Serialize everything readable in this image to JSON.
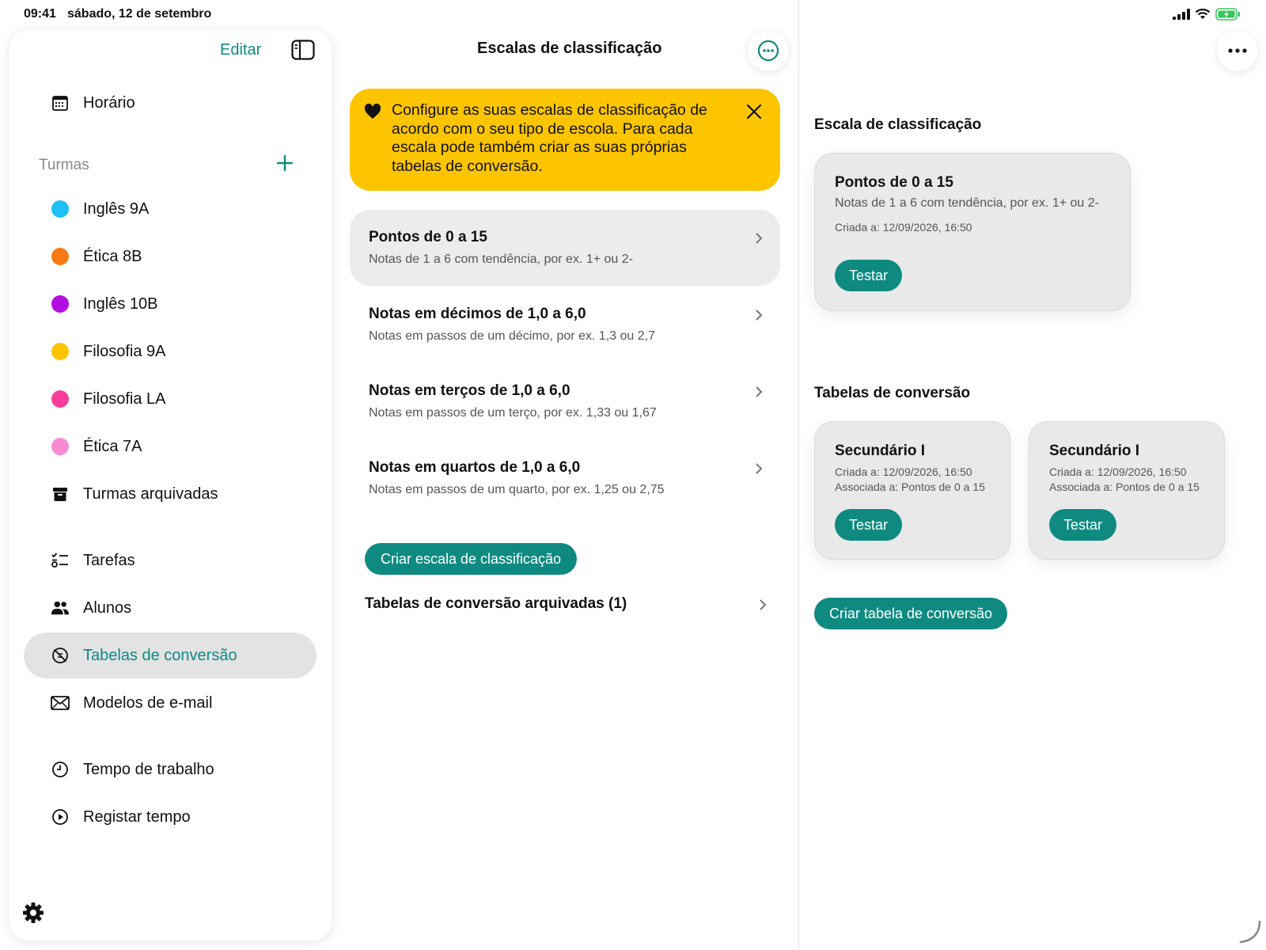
{
  "statusbar": {
    "time": "09:41",
    "date": "sábado, 12 de setembro"
  },
  "sidebar": {
    "edit_label": "Editar",
    "schedule_label": "Horário",
    "classes_header": "Turmas",
    "classes": [
      {
        "label": "Inglês 9A",
        "color": "#1ec0f5"
      },
      {
        "label": "Ética 8B",
        "color": "#f97a14"
      },
      {
        "label": "Inglês 10B",
        "color": "#b40fe0"
      },
      {
        "label": "Filosofia 9A",
        "color": "#fdc500"
      },
      {
        "label": "Filosofia LA",
        "color": "#f83d9a"
      },
      {
        "label": "Ética 7A",
        "color": "#f88ad4"
      }
    ],
    "archived_classes_label": "Turmas arquivadas",
    "tasks_label": "Tarefas",
    "students_label": "Alunos",
    "conversion_tables_label": "Tabelas de conversão",
    "email_templates_label": "Modelos de e-mail",
    "work_time_label": "Tempo de trabalho",
    "register_time_label": "Registar tempo"
  },
  "middle": {
    "title": "Escalas de classificação",
    "banner_text": "Configure as suas escalas de classificação de acordo com o seu tipo de escola. Para cada escala pode também criar as suas próprias tabelas de conversão.",
    "scales": [
      {
        "title": "Pontos de 0 a 15",
        "subtitle": "Notas de 1 a 6 com tendência, por ex. 1+ ou 2-"
      },
      {
        "title": "Notas em décimos de 1,0 a 6,0",
        "subtitle": "Notas em passos de um décimo, por ex. 1,3 ou 2,7"
      },
      {
        "title": "Notas em terços de 1,0 a 6,0",
        "subtitle": "Notas em passos de um terço, por ex. 1,33 ou 1,67"
      },
      {
        "title": "Notas em quartos de 1,0 a 6,0",
        "subtitle": "Notas em passos de um quarto, por ex. 1,25 ou 2,75"
      }
    ],
    "create_scale_label": "Criar escala de classificação",
    "archived_tables_label": "Tabelas de conversão arquivadas (1)"
  },
  "right": {
    "scale_section": "Escala de classificação",
    "scale_card": {
      "title": "Pontos de 0 a 15",
      "subtitle": "Notas de 1 a 6 com tendência, por ex. 1+ ou 2-",
      "created": "Criada a: 12/09/2026, 16:50",
      "test_label": "Testar"
    },
    "tables_section": "Tabelas de conversão",
    "tables": [
      {
        "title": "Secundário I",
        "created": "Criada a: 12/09/2026, 16:50",
        "associated": "Associada a: Pontos de 0 a 15",
        "test_label": "Testar"
      },
      {
        "title": "Secundário I",
        "created": "Criada a: 12/09/2026, 16:50",
        "associated": "Associada a: Pontos de 0 a 15",
        "test_label": "Testar"
      }
    ],
    "create_table_label": "Criar tabela de conversão"
  },
  "colors": {
    "accent": "#0f8a80",
    "banner": "#fdc500",
    "selected_bg": "#e3e3e3"
  }
}
